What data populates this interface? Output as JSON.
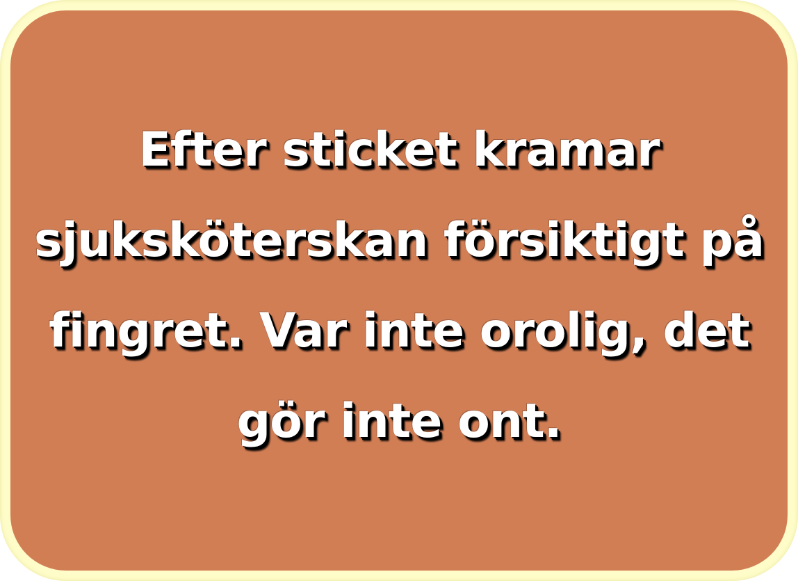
{
  "card": {
    "text": "Efter sticket kramar sjuksköterskan försiktigt på fingret. Var inte orolig, det gör inte ont.",
    "colors": {
      "frame": "#fefcc8",
      "background": "#d27e55",
      "text": "#ffffff",
      "text_shadow": "#000000"
    }
  }
}
